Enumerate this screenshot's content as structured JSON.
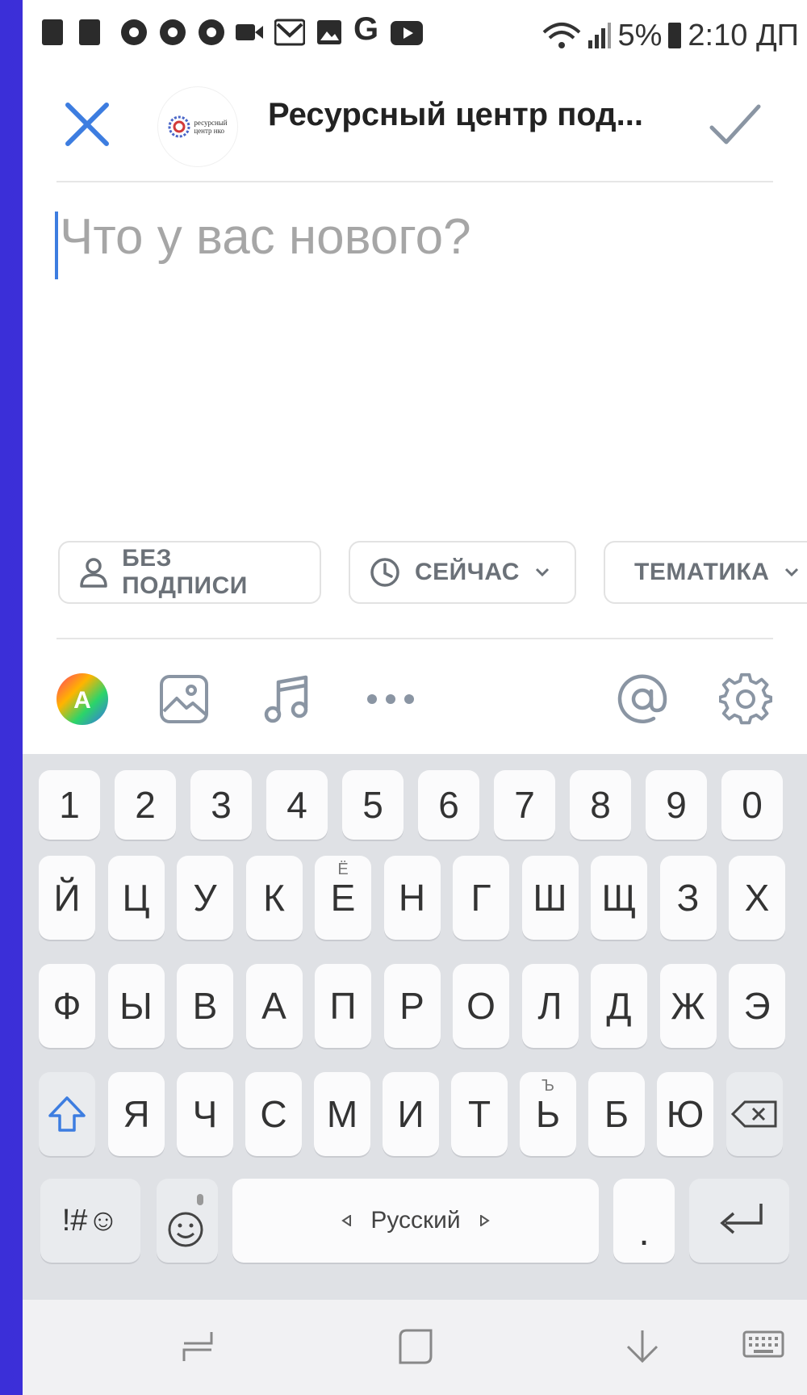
{
  "status": {
    "battery_percent": "5%",
    "time": "2:10 ДП"
  },
  "header": {
    "title": "Ресурсный центр под...",
    "logo_text_line1": "ресурсный",
    "logo_text_line2": "центр нко"
  },
  "compose": {
    "placeholder": "Что у вас нового?"
  },
  "chips": {
    "signature": "БЕЗ ПОДПИСИ",
    "time": "СЕЙЧАС",
    "topic": "ТЕМАТИКА"
  },
  "keyboard": {
    "numbers": [
      "1",
      "2",
      "3",
      "4",
      "5",
      "6",
      "7",
      "8",
      "9",
      "0"
    ],
    "row1": [
      "Й",
      "Ц",
      "У",
      "К",
      "Е",
      "Н",
      "Г",
      "Ш",
      "Щ",
      "З",
      "Х"
    ],
    "row1_alt_e": "Ё",
    "row2": [
      "Ф",
      "Ы",
      "В",
      "А",
      "П",
      "Р",
      "О",
      "Л",
      "Д",
      "Ж",
      "Э"
    ],
    "row3": [
      "Я",
      "Ч",
      "С",
      "М",
      "И",
      "Т",
      "Ь",
      "Б",
      "Ю"
    ],
    "row3_alt_soft": "Ъ",
    "symbols_key": "!#☺",
    "space_label": "Русский",
    "period_key": "."
  },
  "colors": {
    "accent": "#3d7de0",
    "keyboard_bg": "#dfe1e5"
  }
}
